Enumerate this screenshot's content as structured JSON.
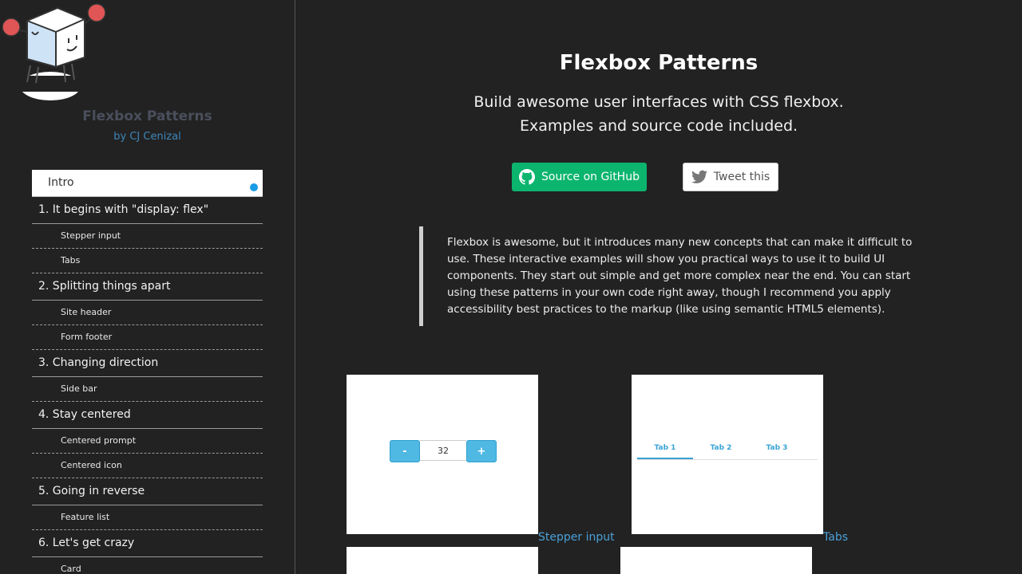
{
  "brand": {
    "title": "Flexbox Patterns",
    "by_prefix": "by",
    "author": "CJ Cenizal"
  },
  "nav": {
    "items": [
      {
        "label": "Intro",
        "type": "active"
      },
      {
        "label": "1. It begins with \"display: flex\"",
        "type": "section"
      },
      {
        "label": "Stepper input",
        "type": "sub"
      },
      {
        "label": "Tabs",
        "type": "sub"
      },
      {
        "label": "2. Splitting things apart",
        "type": "section"
      },
      {
        "label": "Site header",
        "type": "sub"
      },
      {
        "label": "Form footer",
        "type": "sub"
      },
      {
        "label": "3. Changing direction",
        "type": "section"
      },
      {
        "label": "Side bar",
        "type": "sub"
      },
      {
        "label": "4. Stay centered",
        "type": "section"
      },
      {
        "label": "Centered prompt",
        "type": "sub"
      },
      {
        "label": "Centered icon",
        "type": "sub"
      },
      {
        "label": "5. Going in reverse",
        "type": "section"
      },
      {
        "label": "Feature list",
        "type": "sub"
      },
      {
        "label": "6. Let's get crazy",
        "type": "section"
      },
      {
        "label": "Card",
        "type": "sub"
      }
    ]
  },
  "main": {
    "title": "Flexbox Patterns",
    "subtitle_line1": "Build awesome user interfaces with CSS flexbox.",
    "subtitle_line2": "Examples and source code included.",
    "github_button": "Source on GitHub",
    "tweet_button": "Tweet this",
    "intro": "Flexbox is awesome, but it introduces many new concepts that can make it difficult to use. These interactive examples will show you practical ways to use it to build UI components. They start out simple and get more complex near the end. You can start using these patterns in your own code right away, though I recommend you apply accessibility best practices to the markup (like using semantic HTML5 elements).",
    "examples": [
      {
        "label": "Stepper input"
      },
      {
        "label": "Tabs"
      }
    ],
    "stepper_preview": {
      "minus": "-",
      "value": "32",
      "plus": "+"
    },
    "tabs_preview": [
      "Tab 1",
      "Tab 2",
      "Tab 3"
    ]
  },
  "colors": {
    "background": "#222222",
    "accent_green": "#0bb56e",
    "link_blue": "#4aa0d8",
    "active_dot": "#1a9be6"
  }
}
